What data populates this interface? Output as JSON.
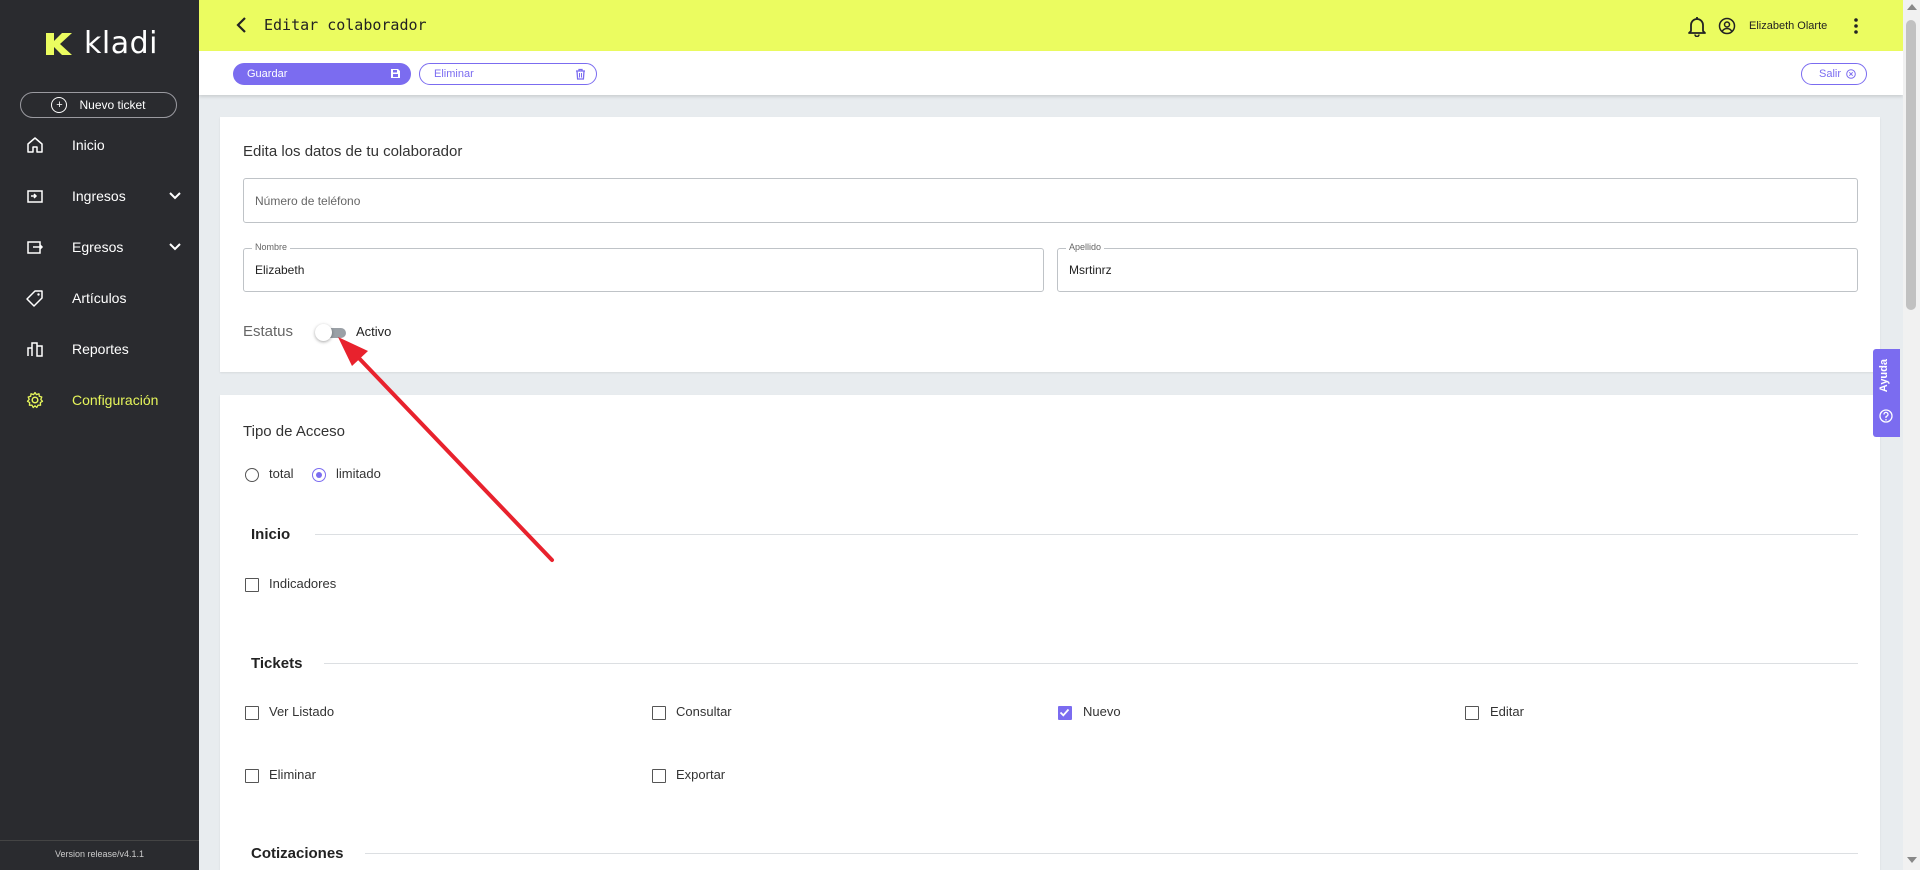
{
  "sidebar": {
    "logo_text": "kladi",
    "new_ticket_label": "Nuevo ticket",
    "items": [
      {
        "label": "Inicio",
        "icon": "home-icon"
      },
      {
        "label": "Ingresos",
        "icon": "ingresos-icon",
        "expandable": true
      },
      {
        "label": "Egresos",
        "icon": "egresos-icon",
        "expandable": true
      },
      {
        "label": "Artículos",
        "icon": "tag-icon"
      },
      {
        "label": "Reportes",
        "icon": "chart-icon"
      },
      {
        "label": "Configuración",
        "icon": "gear-icon",
        "active": true
      }
    ],
    "version": "Version release/v4.1.1"
  },
  "header": {
    "title": "Editar colaborador",
    "user_name": "Elizabeth Olarte"
  },
  "toolbar": {
    "save_label": "Guardar",
    "delete_label": "Eliminar",
    "exit_label": "Salir"
  },
  "form": {
    "section_title": "Edita los datos de tu colaborador",
    "phone_placeholder": "Número de teléfono",
    "nombre_label": "Nombre",
    "nombre_value": "Elizabeth",
    "apellido_label": "Apellido",
    "apellido_value": "Msrtinrz",
    "estatus_label": "Estatus",
    "estatus_value": "Activo"
  },
  "access": {
    "title": "Tipo de Acceso",
    "options": [
      {
        "label": "total",
        "selected": false
      },
      {
        "label": "limitado",
        "selected": true
      }
    ],
    "groups": {
      "inicio": {
        "title": "Inicio",
        "perms": [
          {
            "label": "Indicadores",
            "checked": false
          }
        ]
      },
      "tickets": {
        "title": "Tickets",
        "perms": [
          {
            "label": "Ver Listado",
            "checked": false
          },
          {
            "label": "Consultar",
            "checked": false
          },
          {
            "label": "Nuevo",
            "checked": true
          },
          {
            "label": "Editar",
            "checked": false
          },
          {
            "label": "Eliminar",
            "checked": false
          },
          {
            "label": "Exportar",
            "checked": false
          }
        ]
      },
      "cotizaciones": {
        "title": "Cotizaciones"
      }
    }
  },
  "help": {
    "label": "Ayuda"
  },
  "colors": {
    "accent": "#7b6cf0",
    "topbar": "#ebfc60",
    "sidebar": "#2a2b2f",
    "active_nav": "#e6f55b",
    "annotation_arrow": "#e8222d"
  }
}
